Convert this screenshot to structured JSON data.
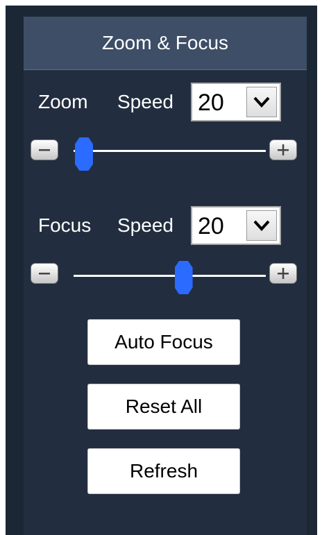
{
  "panel": {
    "title": "Zoom & Focus"
  },
  "zoom": {
    "label": "Zoom",
    "speed_label": "Speed",
    "speed_value": "20",
    "slider_level": 0.0,
    "decrease_icon": "minus-icon",
    "increase_icon": "plus-icon"
  },
  "focus": {
    "label": "Focus",
    "speed_label": "Speed",
    "speed_value": "20",
    "slider_level": 0.55,
    "decrease_icon": "minus-icon",
    "increase_icon": "plus-icon"
  },
  "buttons": {
    "auto_focus": "Auto Focus",
    "reset_all": "Reset All",
    "refresh": "Refresh"
  },
  "colors": {
    "background": "#1c2735",
    "panel": "#222e3f",
    "header": "#3d4e66",
    "slider_thumb": "#2c6bff"
  }
}
